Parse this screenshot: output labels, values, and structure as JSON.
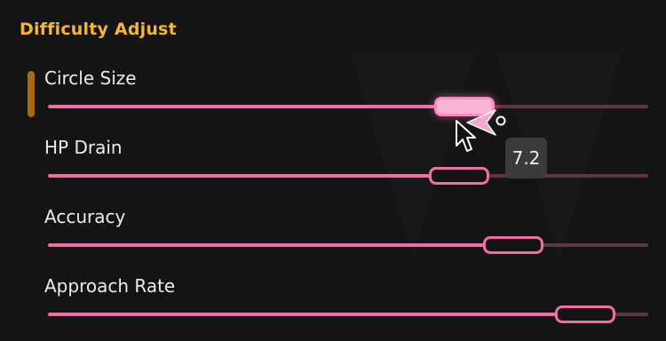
{
  "section": {
    "title": "Difficulty Adjust"
  },
  "sliders": [
    {
      "label": "Circle Size",
      "fraction": 0.69,
      "active": true
    },
    {
      "label": "HP Drain",
      "fraction": 0.68,
      "active": false
    },
    {
      "label": "Accuracy",
      "fraction": 0.77,
      "active": false
    },
    {
      "label": "Approach Rate",
      "fraction": 0.89,
      "active": false
    }
  ],
  "tooltip": {
    "value": "7.2"
  },
  "colors": {
    "accent": "#f5b731",
    "slider": "#ef6fa5",
    "slider_rest": "#5e3646",
    "background": "#141414"
  },
  "icons": {
    "cursor": "game-cursor-icon"
  }
}
